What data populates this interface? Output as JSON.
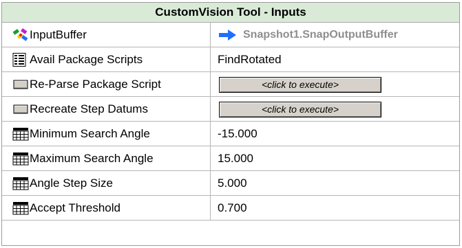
{
  "title": "CustomVision Tool - Inputs",
  "rows": [
    {
      "label": "InputBuffer",
      "value": "Snapshot1.SnapOutputBuffer",
      "icon": "multicolor-link-icon"
    },
    {
      "label": "Avail Package Scripts",
      "value": "FindRotated",
      "icon": "script-list-icon"
    },
    {
      "label": "Re-Parse Package Script",
      "button_label": "<click to execute>",
      "icon": "button-icon"
    },
    {
      "label": "Recreate Step Datums",
      "button_label": "<click to execute>",
      "icon": "button-icon"
    },
    {
      "label": "Minimum Search Angle",
      "value": "-15.000",
      "icon": "numeric-keypad-icon"
    },
    {
      "label": "Maximum Search Angle",
      "value": "15.000",
      "icon": "numeric-keypad-icon"
    },
    {
      "label": "Angle Step Size",
      "value": "5.000",
      "icon": "numeric-keypad-icon"
    },
    {
      "label": "Accept Threshold",
      "value": "0.700",
      "icon": "numeric-keypad-icon"
    }
  ],
  "colors": {
    "title_background": "#d9ebd7",
    "link_arrow": "#1f6fff",
    "linked_text": "#8e8e8e",
    "button_face": "#d6d2cb"
  }
}
